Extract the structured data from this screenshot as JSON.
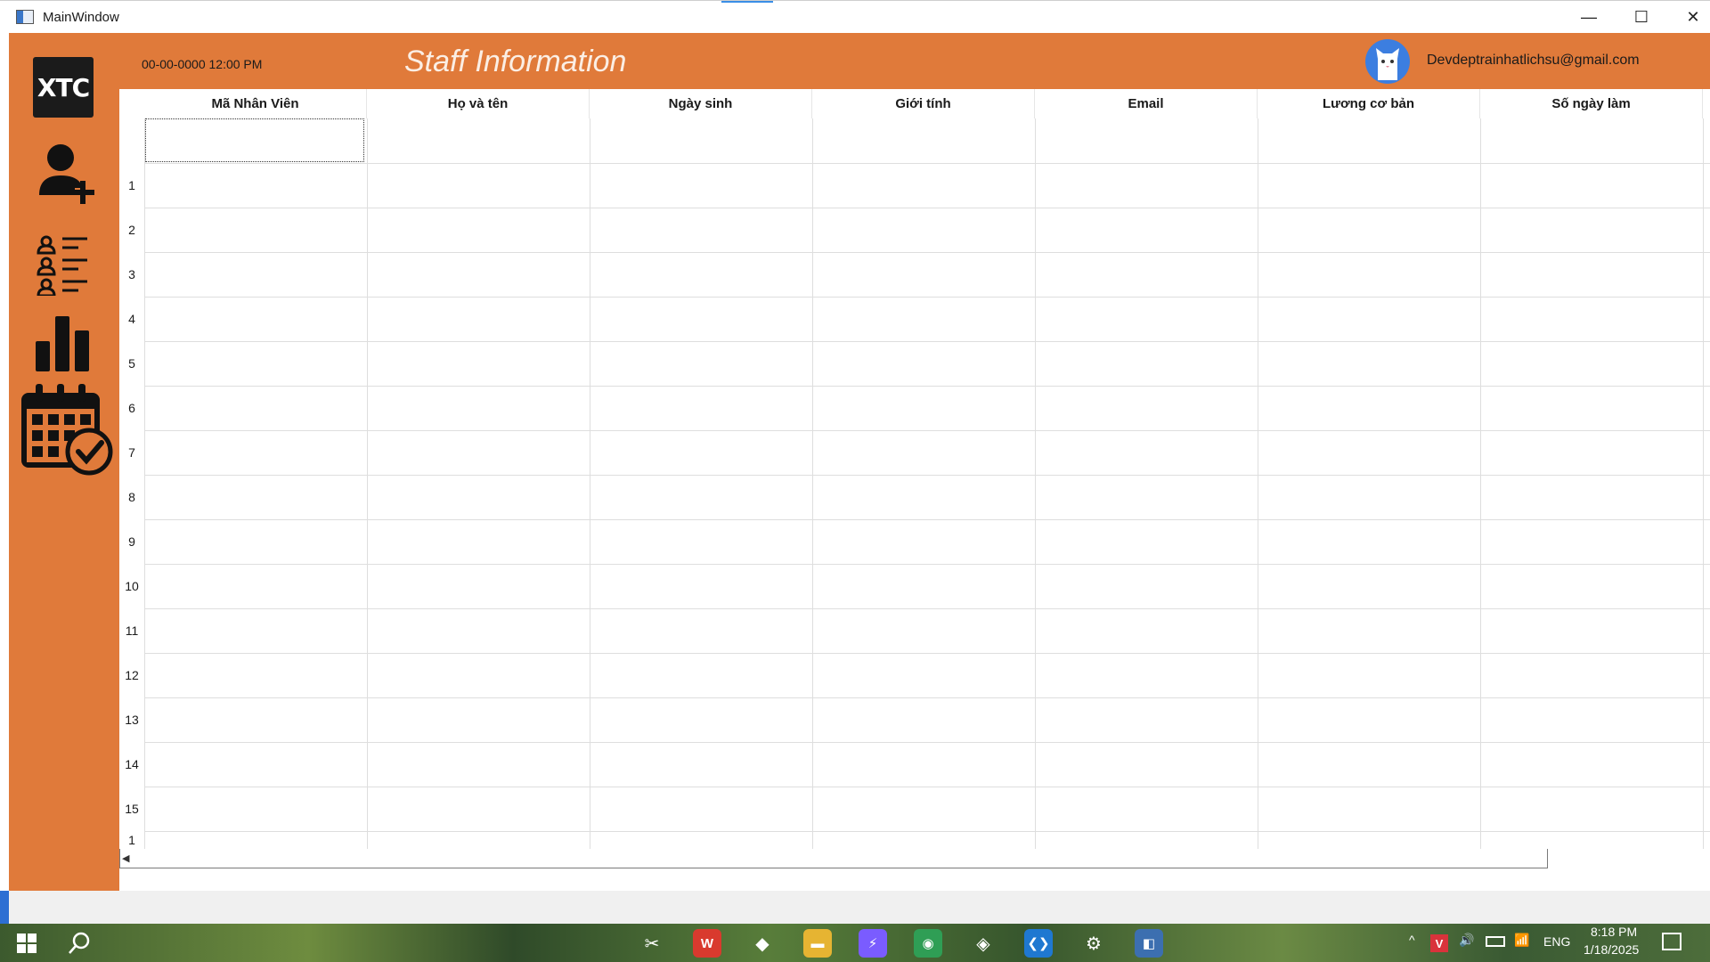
{
  "window": {
    "title": "MainWindow",
    "minimize_glyph": "—",
    "maximize_glyph": "☐",
    "close_glyph": "✕"
  },
  "sidebar": {
    "logo_text": "XTC",
    "items": [
      {
        "name": "add-user-icon"
      },
      {
        "name": "staff-list-icon"
      },
      {
        "name": "statistics-icon"
      },
      {
        "name": "calendar-check-icon"
      }
    ]
  },
  "header": {
    "datetime": "00-00-0000 12:00 PM",
    "title": "Staff Information",
    "user_email": "Devdeptrainhatlichsu@gmail.com",
    "colors": {
      "accent": "#e07a3a",
      "avatar_bg": "#3c7ee0"
    }
  },
  "table": {
    "columns": [
      "Mã Nhân Viên",
      "Họ và tên",
      "Ngày sinh",
      "Giới tính",
      "Email",
      "Lương cơ bản",
      "Số ngày làm"
    ],
    "row_headers": [
      "",
      "1",
      "2",
      "3",
      "4",
      "5",
      "6",
      "7",
      "8",
      "9",
      "10",
      "11",
      "12",
      "13",
      "14",
      "15",
      "1"
    ]
  },
  "taskbar": {
    "start_icon": "windows-start-icon",
    "search_icon": "search-icon",
    "pinned": [
      "snipping-tool-icon",
      "wps-office-icon",
      "copilot-icon",
      "file-explorer-icon",
      "messenger-icon",
      "chrome-icon",
      "roblox-icon",
      "vscode-icon",
      "settings-icon",
      "python-icon"
    ],
    "tray": {
      "language": "ENG",
      "time": "8:18 PM",
      "date": "1/18/2025",
      "chevron": "^"
    }
  }
}
